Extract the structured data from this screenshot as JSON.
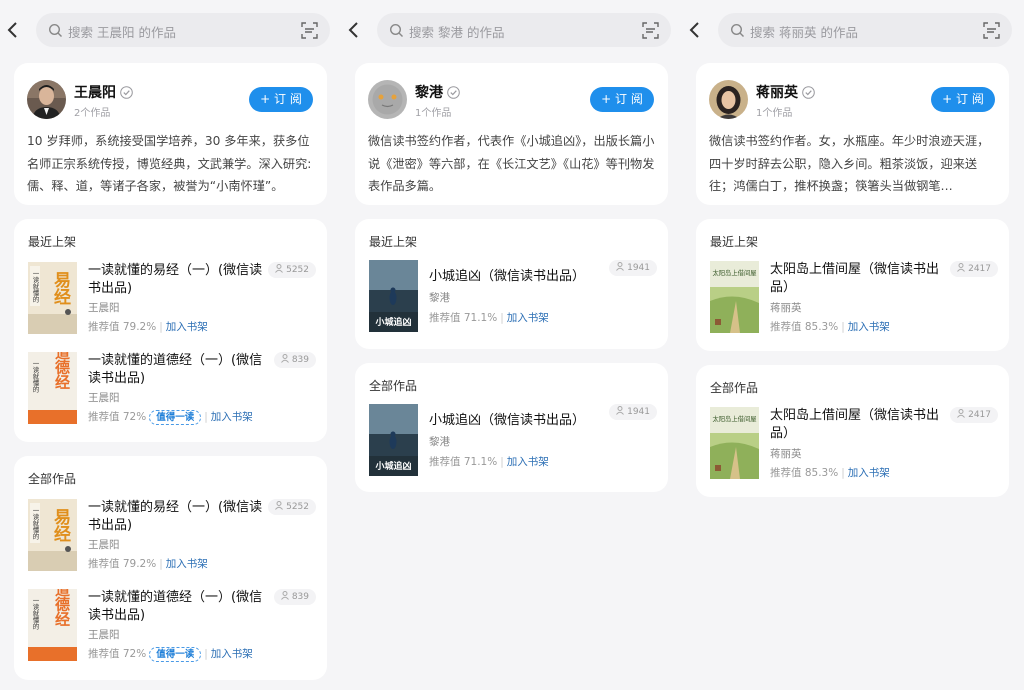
{
  "panels": [
    {
      "search_placeholder": "搜索 王晨阳 的作品",
      "author": {
        "name": "王晨阳",
        "works_count": "2个作品",
        "subscribe_label": "+ 订 阅",
        "bio": "10 岁拜师，系统接受国学培养，30 多年来，获多位名师正宗系统传授，博览经典，文武兼学。深入研究:儒、释、道，等诸子各家，被誉为“小南怀瑾”。"
      },
      "recent_title": "最近上架",
      "all_title": "全部作品",
      "recent_books": [
        {
          "title": "一读就懂的易经（一）(微信读书出品)",
          "author": "王晨阳",
          "rating": "推荐值 79.2%",
          "add": "加入书架",
          "reads": "5252",
          "badge": ""
        },
        {
          "title": "一读就懂的道德经（一）(微信读书出品)",
          "author": "王晨阳",
          "rating": "推荐值 72%",
          "add": "加入书架",
          "reads": "839",
          "badge": "值得一读"
        }
      ],
      "all_books": [
        {
          "title": "一读就懂的易经（一）(微信读书出品)",
          "author": "王晨阳",
          "rating": "推荐值 79.2%",
          "add": "加入书架",
          "reads": "5252",
          "badge": ""
        },
        {
          "title": "一读就懂的道德经（一）(微信读书出品)",
          "author": "王晨阳",
          "rating": "推荐值 72%",
          "add": "加入书架",
          "reads": "839",
          "badge": "值得一读"
        }
      ]
    },
    {
      "search_placeholder": "搜索 黎港 的作品",
      "author": {
        "name": "黎港",
        "works_count": "1个作品",
        "subscribe_label": "+ 订 阅",
        "bio": "微信读书签约作者，代表作《小城追凶》，出版长篇小说《泄密》等六部，在《长江文艺》《山花》等刊物发表作品多篇。"
      },
      "recent_title": "最近上架",
      "all_title": "全部作品",
      "recent_books": [
        {
          "title": "小城追凶（微信读书出品）",
          "author": "黎港",
          "rating": "推荐值 71.1%",
          "add": "加入书架",
          "reads": "1941",
          "badge": ""
        }
      ],
      "all_books": [
        {
          "title": "小城追凶（微信读书出品）",
          "author": "黎港",
          "rating": "推荐值 71.1%",
          "add": "加入书架",
          "reads": "1941",
          "badge": ""
        }
      ]
    },
    {
      "search_placeholder": "搜索 蒋丽英 的作品",
      "author": {
        "name": "蒋丽英",
        "works_count": "1个作品",
        "subscribe_label": "+ 订 阅",
        "bio": "微信读书签约作者。女，水瓶座。年少时浪迹天涯，四十岁时辞去公职，隐入乡间。粗茶淡饭，迎来送往；鸿儒白丁，推杯换盏；筷箸头当做钢笔…"
      },
      "recent_title": "最近上架",
      "all_title": "全部作品",
      "recent_books": [
        {
          "title": "太阳岛上借间屋（微信读书出品）",
          "author": "蒋丽英",
          "rating": "推荐值 85.3%",
          "add": "加入书架",
          "reads": "2417",
          "badge": ""
        }
      ],
      "all_books": [
        {
          "title": "太阳岛上借间屋（微信读书出品）",
          "author": "蒋丽英",
          "rating": "推荐值 85.3%",
          "add": "加入书架",
          "reads": "2417",
          "badge": ""
        }
      ]
    }
  ],
  "cover_text": {
    "yijing_side": "一读就懂的",
    "yijing_big": "易经",
    "daode_side": "一读就懂的",
    "daode_big": "道德经",
    "xiaocheng": "小城追凶",
    "taiyang": "太阳岛上借间屋"
  },
  "colors": {
    "accent": "#1f8fec",
    "link": "#2c6fb5",
    "background": "#f5f5f7"
  }
}
